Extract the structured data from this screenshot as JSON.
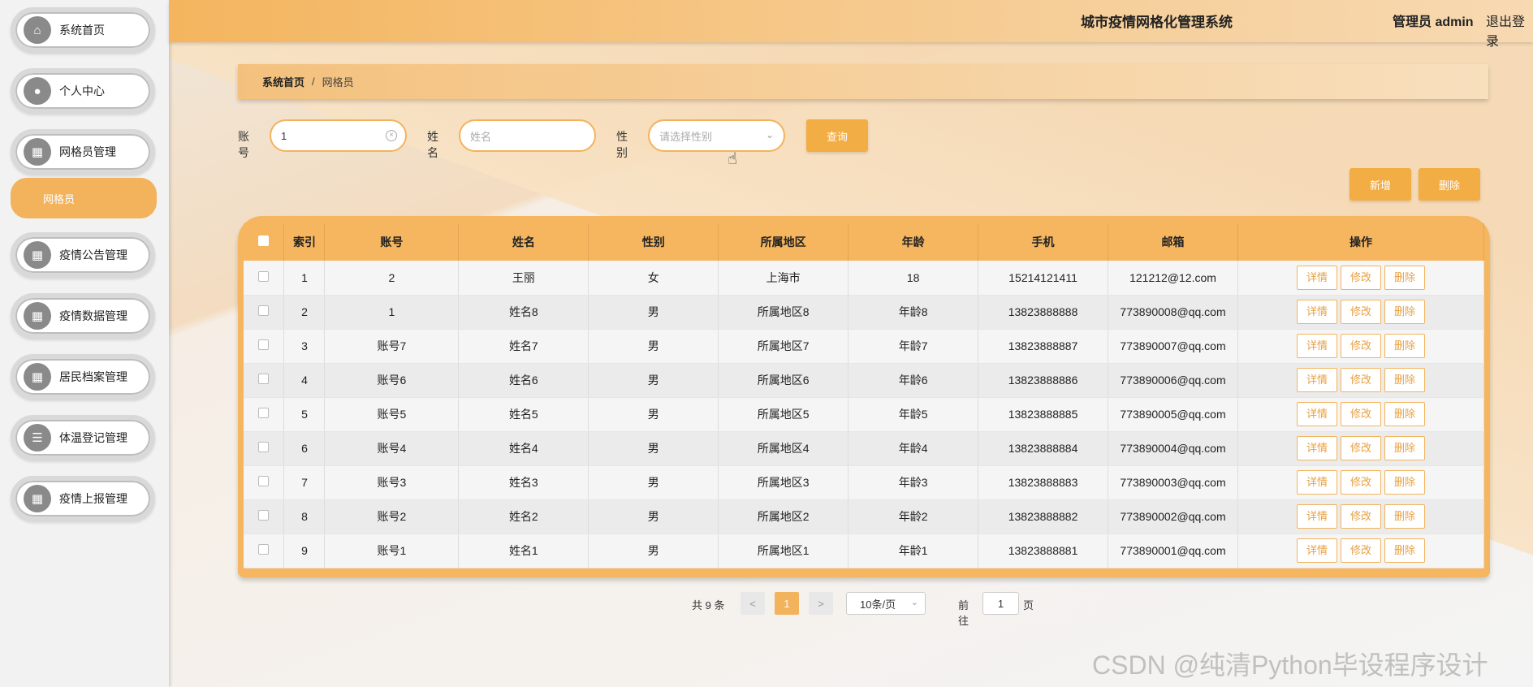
{
  "header": {
    "title": "城市疫情网格化管理系统",
    "user": "管理员 admin",
    "logout": "退出登录"
  },
  "sidebar": {
    "items": [
      {
        "label": "系统首页",
        "icon": "home-icon"
      },
      {
        "label": "个人中心",
        "icon": "user-icon"
      },
      {
        "label": "网格员管理",
        "icon": "grid-icon"
      },
      {
        "label": "疫情公告管理",
        "icon": "grid-icon"
      },
      {
        "label": "疫情数据管理",
        "icon": "grid-icon"
      },
      {
        "label": "居民档案管理",
        "icon": "grid-icon"
      },
      {
        "label": "体温登记管理",
        "icon": "list-icon"
      },
      {
        "label": "疫情上报管理",
        "icon": "grid-icon"
      }
    ],
    "sub_item": "网格员"
  },
  "breadcrumb": {
    "home": "系统首页",
    "sep": "/",
    "current": "网格员"
  },
  "search": {
    "account_label": "账号",
    "account_value": "1",
    "name_label": "姓名",
    "name_placeholder": "姓名",
    "gender_label": "性别",
    "gender_placeholder": "请选择性别",
    "query_button": "查询"
  },
  "actions": {
    "add": "新增",
    "delete": "删除"
  },
  "table": {
    "headers": [
      "索引",
      "账号",
      "姓名",
      "性别",
      "所属地区",
      "年龄",
      "手机",
      "邮箱",
      "操作"
    ],
    "row_actions": [
      "详情",
      "修改",
      "删除"
    ],
    "rows": [
      [
        "1",
        "2",
        "王丽",
        "女",
        "上海市",
        "18",
        "15214121411",
        "121212@12.com"
      ],
      [
        "2",
        "1",
        "姓名8",
        "男",
        "所属地区8",
        "年龄8",
        "13823888888",
        "773890008@qq.com"
      ],
      [
        "3",
        "账号7",
        "姓名7",
        "男",
        "所属地区7",
        "年龄7",
        "13823888887",
        "773890007@qq.com"
      ],
      [
        "4",
        "账号6",
        "姓名6",
        "男",
        "所属地区6",
        "年龄6",
        "13823888886",
        "773890006@qq.com"
      ],
      [
        "5",
        "账号5",
        "姓名5",
        "男",
        "所属地区5",
        "年龄5",
        "13823888885",
        "773890005@qq.com"
      ],
      [
        "6",
        "账号4",
        "姓名4",
        "男",
        "所属地区4",
        "年龄4",
        "13823888884",
        "773890004@qq.com"
      ],
      [
        "7",
        "账号3",
        "姓名3",
        "男",
        "所属地区3",
        "年龄3",
        "13823888883",
        "773890003@qq.com"
      ],
      [
        "8",
        "账号2",
        "姓名2",
        "男",
        "所属地区2",
        "年龄2",
        "13823888882",
        "773890002@qq.com"
      ],
      [
        "9",
        "账号1",
        "姓名1",
        "男",
        "所属地区1",
        "年龄1",
        "13823888881",
        "773890001@qq.com"
      ]
    ]
  },
  "pagination": {
    "total": "共 9 条",
    "prev": "<",
    "current_page": "1",
    "next": ">",
    "page_size": "10条/页",
    "goto_label": "前往",
    "goto_value": "1",
    "page_label": "页"
  },
  "watermark": "CSDN @纯清Python毕设程序设计",
  "colors": {
    "accent": "#f2b35c",
    "button": "#f2ad45"
  }
}
